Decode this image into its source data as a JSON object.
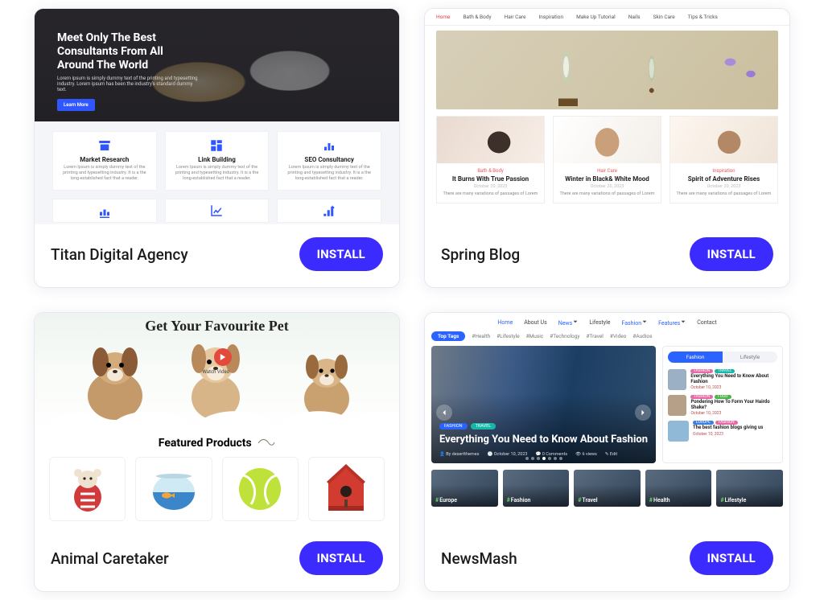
{
  "install_label": "INSTALL",
  "themes": [
    {
      "id": "titan",
      "title": "Titan Digital Agency"
    },
    {
      "id": "spring",
      "title": "Spring Blog"
    },
    {
      "id": "animal",
      "title": "Animal Caretaker"
    },
    {
      "id": "news",
      "title": "NewsMash"
    }
  ],
  "titan": {
    "headline": "Meet Only The Best Consultants From All Around The World",
    "sub": "Lorem ipsum is simply dummy text of the printing and typesetting industry. Lorem ipsum has been the industry's standard dummy text.",
    "cta": "Learn More",
    "services": [
      {
        "name": "Market Research",
        "desc": "Lorem Ipsum is simply dummy text of the printing and typesetting industry. It is a the long-established fact that a reader."
      },
      {
        "name": "Link Building",
        "desc": "Lorem Ipsum is simply dummy text of the printing and typesetting industry. It is a the long-established fact that a reader."
      },
      {
        "name": "SEO Consultancy",
        "desc": "Lorem Ipsum is simply dummy text of the printing and typesetting industry. It is a the long-established fact that a reader."
      }
    ]
  },
  "spring": {
    "nav": [
      "Home",
      "Bath & Body",
      "Hair Care",
      "Inspiration",
      "Make Up Tutorial",
      "Nails",
      "Skin Care",
      "Tips & Tricks"
    ],
    "posts": [
      {
        "cat": "Bath & Body",
        "title": "It Burns With True Passion",
        "date": "October 20, 2023",
        "excerpt": "There are many variations of passages of Lorem"
      },
      {
        "cat": "Hair Care",
        "title": "Winter in Black& White Mood",
        "date": "October 20, 2023",
        "excerpt": "There are many variations of passages of Lorem"
      },
      {
        "cat": "Inspiration",
        "title": "Spirit of Adventure Rises",
        "date": "October 20, 2023",
        "excerpt": "There are many variations of passages of Lorem"
      }
    ]
  },
  "animal": {
    "headline": "Get Your Favourite Pet",
    "watch": "Watch Video",
    "featured_title": "Featured Products"
  },
  "news": {
    "nav": [
      "Home",
      "About Us",
      "News",
      "Lifestyle",
      "Fashion",
      "Features",
      "Contact"
    ],
    "top_tags_label": "Top Tags",
    "top_tags": [
      "#Health",
      "#Lifestyle",
      "#Music",
      "#Technology",
      "#Travel",
      "#Video",
      "#Audios"
    ],
    "hero": {
      "pill1": "FASHION",
      "pill2": "TRAVEL",
      "title": "Everything You Need to Know About Fashion",
      "meta": [
        "By desertthemes",
        "October 10, 2023",
        "0 Comments",
        "6 views",
        "Edit"
      ]
    },
    "side_tabs": [
      "Fashion",
      "Lifestyle"
    ],
    "side_items": [
      {
        "p1": "FASHION",
        "p1c": "#e66aa6",
        "p2": "TRAVEL",
        "p2c": "#15b7a8",
        "title": "Everything You Need to Know About Fashion",
        "date": "October 10, 2023"
      },
      {
        "p1": "FASHION",
        "p1c": "#e66aa6",
        "p2": "FOOD",
        "p2c": "#4cb34c",
        "title": "Pondering How To Form Your Hairdo Shake?",
        "date": "October 10, 2023"
      },
      {
        "p1": "EUROPE",
        "p1c": "#3b7de0",
        "p2": "FASHION",
        "p2c": "#e66aa6",
        "title": "The best fashion blogs giving us",
        "date": "October 10, 2023"
      }
    ],
    "cats": [
      "Europe",
      "Fashion",
      "Travel",
      "Health",
      "Lifestyle"
    ]
  }
}
